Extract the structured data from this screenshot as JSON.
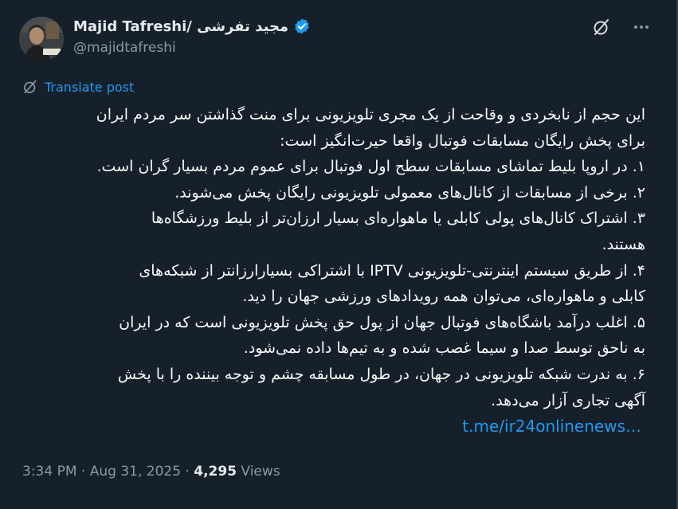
{
  "author": {
    "display_name": "Majid Tafreshi/ مجید تفرشی",
    "handle": "@majidtafreshi",
    "verified": true
  },
  "translate_label": "Translate post",
  "post": {
    "lines": [
      "این حجم از نابخردی و وقاحت از یک مجری تلویزیونی برای منت گذاشتن سر مردم ایران",
      "برای پخش رایگان مسابقات فوتبال واقعا حیرت‌انگیز است:",
      "۱. در اروپا بلیط تماشای مسابقات سطح اول فوتبال برای عموم مردم بسیار گران است.",
      "۲. برخی از مسابقات از کانال‌های معمولی تلویزیونی رایگان پخش می‌شوند.",
      "۳. اشتراک کانال‌های پولی کابلی یا ماهواره‌ای بسیار ارزان‌تر از بلیط ورزشگاه‌ها",
      "هستند.",
      "۴. از طریق سیستم اینترنتی-تلویزیونی IPTV با اشتراکی بسیارارزانتر از شبکه‌های",
      "کابلی و ماهواره‌ای، می‌توان همه رویدادهای ورزشی جهان را دید.",
      "۵. اغلب درآمد باشگاه‌های فوتبال جهان از پول حق پخش تلویزیونی است که در ایران",
      "به ناحق توسط صدا و سیما غصب شده و به تیم‌ها داده نمی‌شود.",
      "۶. به ندرت شبکه تلویزیونی در جهان، در طول مسابقه چشم و توجه بیننده را با پخش",
      "آگهی تجاری آزار می‌دهد."
    ],
    "link": "t.me/ir24onlinenews…"
  },
  "meta": {
    "time": "3:34 PM",
    "separator": " · ",
    "date": "Aug 31, 2025",
    "views_count": "4,295",
    "views_label": " Views"
  },
  "icons": {
    "verified": "verified-badge-icon",
    "grok": "grok-icon",
    "more": "more-icon",
    "translate": "translate-icon"
  },
  "colors": {
    "background": "#15202b",
    "accent": "#1d9bf0",
    "text": "#f7f9f9",
    "muted": "#8b98a5"
  }
}
